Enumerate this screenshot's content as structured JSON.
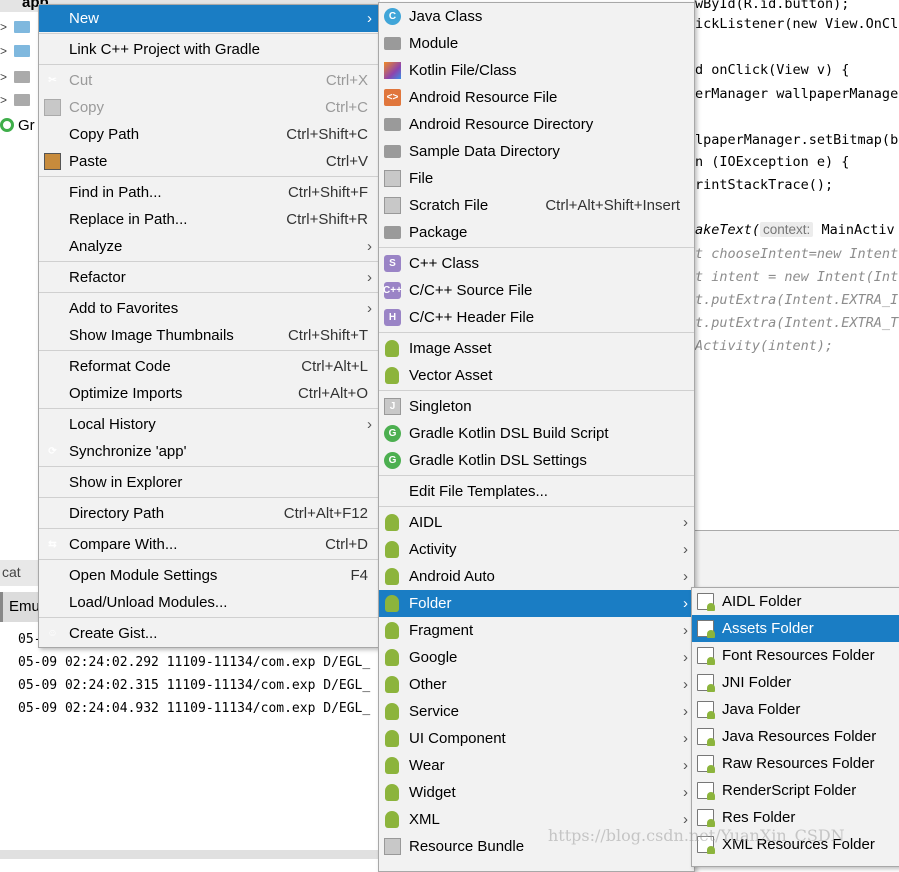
{
  "project_tree": {
    "root": "app",
    "gradle_label": "Gr"
  },
  "editor": {
    "lines": [
      {
        "pre": "",
        "text": "wById(R.id.button);",
        "cls": ""
      },
      {
        "pre": "",
        "text": "ickListener(new View.OnCl",
        "cls": ""
      },
      {
        "pre": "",
        "text": "d onClick(View v) {",
        "cls": ""
      },
      {
        "pre": "",
        "text": "erManager wallpaperManager",
        "cls": ""
      },
      {
        "pre": "",
        "text": "lpaperManager.setBitmap(b",
        "cls": ""
      },
      {
        "pre": "",
        "text": "n (IOException e) {",
        "cls": ""
      },
      {
        "pre": "",
        "text": "rintStackTrace();",
        "cls": ""
      },
      {
        "pre": "",
        "text": "akeText(",
        "cls": ""
      },
      {
        "pre": "",
        "text": "t chooseIntent=new Intent",
        "cls": "cm"
      },
      {
        "pre": "",
        "text": "t intent = new Intent(Int",
        "cls": "cm"
      },
      {
        "pre": "",
        "text": "t.putExtra(Intent.EXTRA_I",
        "cls": "cm"
      },
      {
        "pre": "",
        "text": "t.putExtra(Intent.EXTRA_T",
        "cls": "cm"
      },
      {
        "pre": "",
        "text": "Activity(intent);",
        "cls": "cm"
      }
    ],
    "param_hint": "context:",
    "hint_arg": " MainActiv"
  },
  "logcat": {
    "tab_label": "cat",
    "emulator_tab": "Emu",
    "lines": [
      "05-",
      "05-09 02:24:02.292 11109-11134/com.exp D/EGL_",
      "05-09 02:24:02.315 11109-11134/com.exp D/EGL_",
      "05-09 02:24:04.932 11109-11134/com.exp D/EGL_"
    ]
  },
  "context_menu": [
    {
      "label": "New",
      "arrow": true,
      "highlighted": true
    },
    "sep",
    {
      "label": "Link C++ Project with Gradle"
    },
    "sep",
    {
      "label": "Cut",
      "shortcut": "Ctrl+X",
      "disabled": true,
      "icon": "scissors"
    },
    {
      "label": "Copy",
      "shortcut": "Ctrl+C",
      "disabled": true,
      "icon": "copy"
    },
    {
      "label": "Copy Path",
      "shortcut": "Ctrl+Shift+C"
    },
    {
      "label": "Paste",
      "shortcut": "Ctrl+V",
      "icon": "paste"
    },
    "sep",
    {
      "label": "Find in Path...",
      "shortcut": "Ctrl+Shift+F"
    },
    {
      "label": "Replace in Path...",
      "shortcut": "Ctrl+Shift+R"
    },
    {
      "label": "Analyze",
      "arrow": true
    },
    "sep",
    {
      "label": "Refactor",
      "arrow": true
    },
    "sep",
    {
      "label": "Add to Favorites",
      "arrow": true
    },
    {
      "label": "Show Image Thumbnails",
      "shortcut": "Ctrl+Shift+T"
    },
    "sep",
    {
      "label": "Reformat Code",
      "shortcut": "Ctrl+Alt+L"
    },
    {
      "label": "Optimize Imports",
      "shortcut": "Ctrl+Alt+O"
    },
    "sep",
    {
      "label": "Local History",
      "arrow": true
    },
    {
      "label": "Synchronize 'app'",
      "icon": "sync"
    },
    "sep",
    {
      "label": "Show in Explorer"
    },
    "sep",
    {
      "label": "Directory Path",
      "shortcut": "Ctrl+Alt+F12"
    },
    "sep",
    {
      "label": "Compare With...",
      "shortcut": "Ctrl+D",
      "icon": "compare"
    },
    "sep",
    {
      "label": "Open Module Settings",
      "shortcut": "F4"
    },
    {
      "label": "Load/Unload Modules..."
    },
    "sep",
    {
      "label": "Create Gist...",
      "icon": "gist"
    }
  ],
  "new_submenu": [
    {
      "label": "Java Class",
      "icon": "class",
      "glyph": "C"
    },
    {
      "label": "Module",
      "icon": "folder"
    },
    {
      "label": "Kotlin File/Class",
      "icon": "kotlin"
    },
    {
      "label": "Android Resource File",
      "icon": "res",
      "glyph": "<>"
    },
    {
      "label": "Android Resource Directory",
      "icon": "folder"
    },
    {
      "label": "Sample Data Directory",
      "icon": "folder"
    },
    {
      "label": "File",
      "icon": "file"
    },
    {
      "label": "Scratch File",
      "shortcut": "Ctrl+Alt+Shift+Insert",
      "icon": "file"
    },
    {
      "label": "Package",
      "icon": "folder"
    },
    "sep",
    {
      "label": "C++ Class",
      "icon": "cpp",
      "glyph": "S"
    },
    {
      "label": "C/C++ Source File",
      "icon": "cpp",
      "glyph": "C++"
    },
    {
      "label": "C/C++ Header File",
      "icon": "cpp",
      "glyph": "H"
    },
    "sep",
    {
      "label": "Image Asset",
      "icon": "android"
    },
    {
      "label": "Vector Asset",
      "icon": "android"
    },
    "sep",
    {
      "label": "Singleton",
      "icon": "file",
      "glyph": "J"
    },
    {
      "label": "Gradle Kotlin DSL Build Script",
      "icon": "gradle",
      "glyph": "G"
    },
    {
      "label": "Gradle Kotlin DSL Settings",
      "icon": "gradle",
      "glyph": "G"
    },
    "sep",
    {
      "label": "Edit File Templates..."
    },
    "sep",
    {
      "label": "AIDL",
      "icon": "android",
      "arrow": true
    },
    {
      "label": "Activity",
      "icon": "android",
      "arrow": true
    },
    {
      "label": "Android Auto",
      "icon": "android",
      "arrow": true
    },
    {
      "label": "Folder",
      "icon": "android",
      "arrow": true,
      "highlighted": true
    },
    {
      "label": "Fragment",
      "icon": "android",
      "arrow": true
    },
    {
      "label": "Google",
      "icon": "android",
      "arrow": true
    },
    {
      "label": "Other",
      "icon": "android",
      "arrow": true
    },
    {
      "label": "Service",
      "icon": "android",
      "arrow": true
    },
    {
      "label": "UI Component",
      "icon": "android",
      "arrow": true
    },
    {
      "label": "Wear",
      "icon": "android",
      "arrow": true
    },
    {
      "label": "Widget",
      "icon": "android",
      "arrow": true
    },
    {
      "label": "XML",
      "icon": "android",
      "arrow": true
    },
    {
      "label": "Resource Bundle",
      "icon": "file"
    }
  ],
  "folder_submenu": [
    {
      "label": "AIDL Folder",
      "icon": "assetfolder"
    },
    {
      "label": "Assets Folder",
      "icon": "assetfolder",
      "highlighted": true
    },
    {
      "label": "Font Resources Folder",
      "icon": "assetfolder"
    },
    {
      "label": "JNI Folder",
      "icon": "assetfolder"
    },
    {
      "label": "Java Folder",
      "icon": "assetfolder"
    },
    {
      "label": "Java Resources Folder",
      "icon": "assetfolder"
    },
    {
      "label": "Raw Resources Folder",
      "icon": "assetfolder"
    },
    {
      "label": "RenderScript Folder",
      "icon": "assetfolder"
    },
    {
      "label": "Res Folder",
      "icon": "assetfolder"
    },
    {
      "label": "XML Resources Folder",
      "icon": "assetfolder"
    }
  ],
  "watermark": "https://blog.csdn.net/YuanXin_CSDN",
  "colors": {
    "highlight": "#1a7dc4",
    "menu_bg": "#f2f2f2",
    "android_green": "#8cb43c"
  }
}
